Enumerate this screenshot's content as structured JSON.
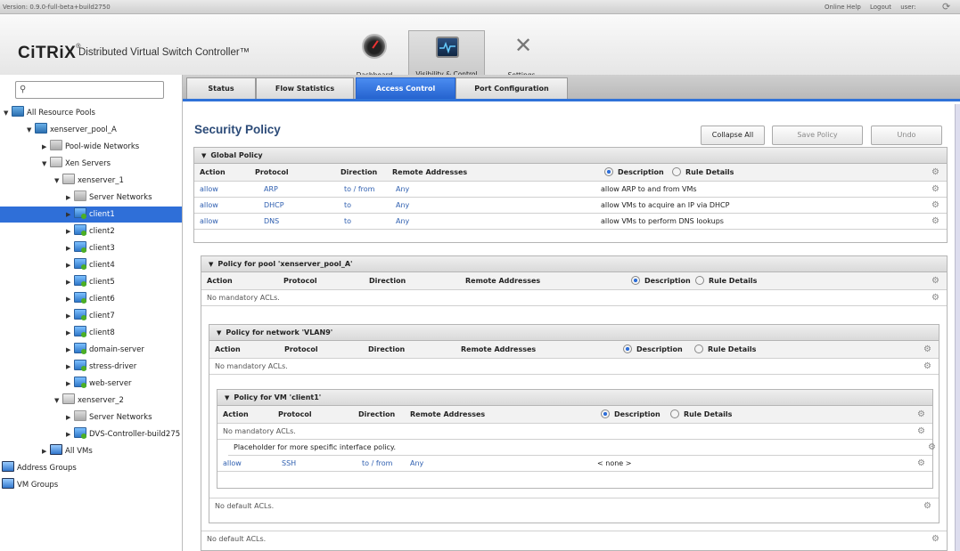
{
  "topbar": {
    "version": "Version: 0.9.0-full-beta+build2750",
    "online_help": "Online Help",
    "logout": "Logout",
    "user": "user:"
  },
  "header": {
    "logo": "CiTRiX",
    "app_title": "Distributed Virtual Switch Controller™",
    "nav": [
      {
        "label": "Dashboard"
      },
      {
        "label": "Visibility & Control"
      },
      {
        "label": "Settings"
      }
    ]
  },
  "sidebar": {
    "search_placeholder": "",
    "tree": [
      {
        "label": "All Resource Pools"
      },
      {
        "label": "xenserver_pool_A"
      },
      {
        "label": "Pool-wide Networks"
      },
      {
        "label": "Xen Servers"
      },
      {
        "label": "xenserver_1"
      },
      {
        "label": "Server Networks"
      },
      {
        "label": "client1"
      },
      {
        "label": "client2"
      },
      {
        "label": "client3"
      },
      {
        "label": "client4"
      },
      {
        "label": "client5"
      },
      {
        "label": "client6"
      },
      {
        "label": "client7"
      },
      {
        "label": "client8"
      },
      {
        "label": "domain-server"
      },
      {
        "label": "stress-driver"
      },
      {
        "label": "web-server"
      },
      {
        "label": "xenserver_2"
      },
      {
        "label": "Server Networks"
      },
      {
        "label": "DVS-Controller-build275"
      },
      {
        "label": "All VMs"
      },
      {
        "label": "Address Groups"
      },
      {
        "label": "VM Groups"
      }
    ],
    "selected": "client1"
  },
  "tabs": [
    {
      "label": "Status"
    },
    {
      "label": "Flow Statistics"
    },
    {
      "label": "Access Control",
      "active": true
    },
    {
      "label": "Port Configuration"
    }
  ],
  "main": {
    "title": "Security Policy",
    "buttons": {
      "collapse": "Collapse All",
      "save": "Save Policy Changes",
      "undo": "Undo Changes"
    },
    "columns": {
      "action": "Action",
      "protocol": "Protocol",
      "direction": "Direction",
      "remote": "Remote Addresses",
      "description": "Description",
      "rule_details": "Rule Details"
    },
    "global": {
      "title": "Global Policy",
      "rules": [
        {
          "action": "allow",
          "protocol": "ARP",
          "direction": "to / from",
          "remote": "Any",
          "desc": "allow ARP to and from VMs"
        },
        {
          "action": "allow",
          "protocol": "DHCP",
          "direction": "to",
          "remote": "Any",
          "desc": "allow VMs to acquire an IP via DHCP"
        },
        {
          "action": "allow",
          "protocol": "DNS",
          "direction": "to",
          "remote": "Any",
          "desc": "allow VMs to perform DNS lookups"
        }
      ]
    },
    "pool": {
      "title": "Policy for pool 'xenserver_pool_A'",
      "mandatory": "No mandatory ACLs.",
      "default": "No default ACLs."
    },
    "network": {
      "title": "Policy for network 'VLAN9'",
      "mandatory": "No mandatory ACLs.",
      "default": "No default ACLs."
    },
    "vm": {
      "title": "Policy for VM 'client1'",
      "mandatory": "No mandatory ACLs.",
      "placeholder": "Placeholder for more specific interface policy.",
      "rule": {
        "action": "allow",
        "protocol": "SSH",
        "direction": "to / from",
        "remote": "Any",
        "desc": "< none >"
      }
    }
  },
  "colors": {
    "accent": "#2f6fd8",
    "title": "#2c4b78",
    "link": "#2f5fb0"
  }
}
